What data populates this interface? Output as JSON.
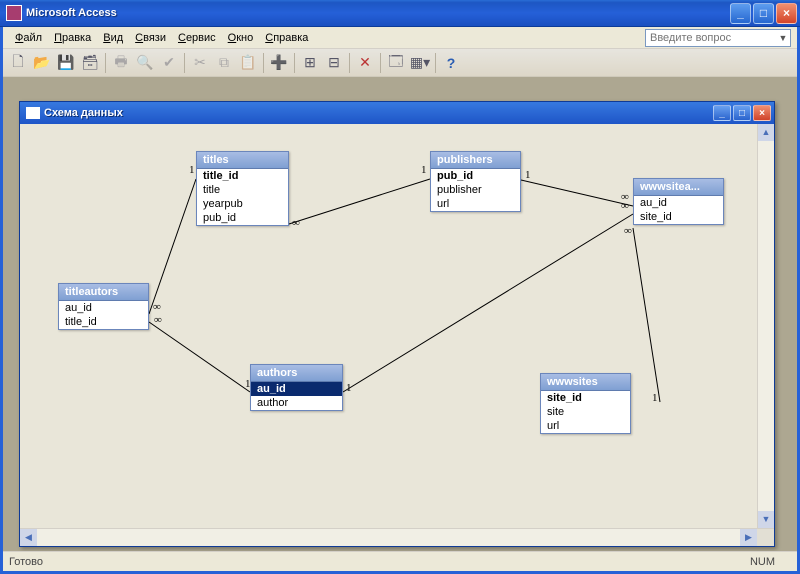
{
  "app": {
    "title": "Microsoft Access"
  },
  "menu": {
    "items": [
      "Файл",
      "Правка",
      "Вид",
      "Связи",
      "Сервис",
      "Окно",
      "Справка"
    ]
  },
  "helpbox": {
    "placeholder": "Введите вопрос"
  },
  "toolbar_icons": [
    "new",
    "open",
    "save",
    "save-all",
    "mail",
    "print",
    "preview",
    "spell",
    "cut",
    "copy",
    "paste",
    "add-table",
    "layout1",
    "layout2",
    "delete",
    "relationships",
    "field-builder",
    "help"
  ],
  "inner": {
    "title": "Схема данных"
  },
  "tables": {
    "titleautors": {
      "name": "titleautors",
      "fields": [
        {
          "label": "au_id",
          "pk": false
        },
        {
          "label": "title_id",
          "pk": false
        }
      ]
    },
    "titles": {
      "name": "titles",
      "fields": [
        {
          "label": "title_id",
          "pk": true
        },
        {
          "label": "title",
          "pk": false
        },
        {
          "label": "yearpub",
          "pk": false
        },
        {
          "label": "pub_id",
          "pk": false
        }
      ]
    },
    "publishers": {
      "name": "publishers",
      "fields": [
        {
          "label": "pub_id",
          "pk": true
        },
        {
          "label": "publisher",
          "pk": false
        },
        {
          "label": "url",
          "pk": false
        }
      ]
    },
    "wwwsitea": {
      "name": "wwwsitea...",
      "fields": [
        {
          "label": "au_id",
          "pk": false
        },
        {
          "label": "site_id",
          "pk": false
        }
      ]
    },
    "authors": {
      "name": "authors",
      "fields": [
        {
          "label": "au_id",
          "pk": true,
          "sel": true
        },
        {
          "label": "author",
          "pk": false
        }
      ]
    },
    "wwwsites": {
      "name": "wwwsites",
      "fields": [
        {
          "label": "site_id",
          "pk": true
        },
        {
          "label": "site",
          "pk": false
        },
        {
          "label": "url",
          "pk": false
        }
      ]
    }
  },
  "rel_labels": {
    "one": "1",
    "many": "∞"
  },
  "status": {
    "msg": "Готово",
    "ind": "NUM"
  }
}
